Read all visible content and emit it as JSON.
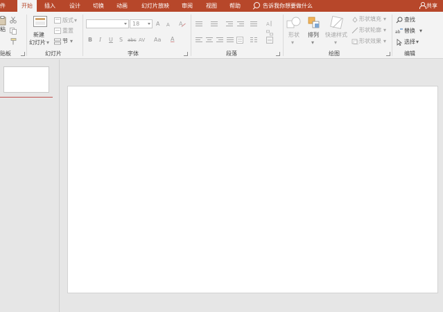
{
  "tabs": {
    "file": "件",
    "home": "开始",
    "insert": "插入",
    "design": "设计",
    "transitions": "切换",
    "animations": "动画",
    "slideshow": "幻灯片放映",
    "review": "审阅",
    "view": "视图",
    "help": "帮助"
  },
  "search": {
    "hint": "告诉我你想要做什么"
  },
  "share": {
    "label": "共享"
  },
  "clipboard": {
    "paste_label": "粘",
    "group_label": "贴板"
  },
  "slides": {
    "new_slide_line1": "新建",
    "new_slide_line2": "幻灯片",
    "layout": "版式",
    "reset": "重置",
    "section": "节",
    "group_label": "幻灯片"
  },
  "font": {
    "font_name": "",
    "font_size": "18",
    "grow": "A",
    "shrink": "A",
    "bold": "B",
    "italic": "I",
    "underline": "U",
    "shadow": "S",
    "strike": "abc",
    "spacing": "AV",
    "case": "Aa",
    "color": "A",
    "group_label": "字体"
  },
  "paragraph": {
    "group_label": "段落"
  },
  "drawing": {
    "shapes": "形状",
    "arrange": "排列",
    "quick_styles": "快速样式",
    "shape_fill": "形状填充",
    "shape_outline": "形状轮廓",
    "shape_effects": "形状效果",
    "group_label": "绘图"
  },
  "editing": {
    "find": "查找",
    "replace": "替换",
    "select": "选择",
    "group_label": "编辑"
  },
  "colors": {
    "accent": "#b7472a",
    "ribbon_bg": "#f3f3f3",
    "workspace_bg": "#e6e6e6",
    "selection_line": "#c0504d"
  }
}
